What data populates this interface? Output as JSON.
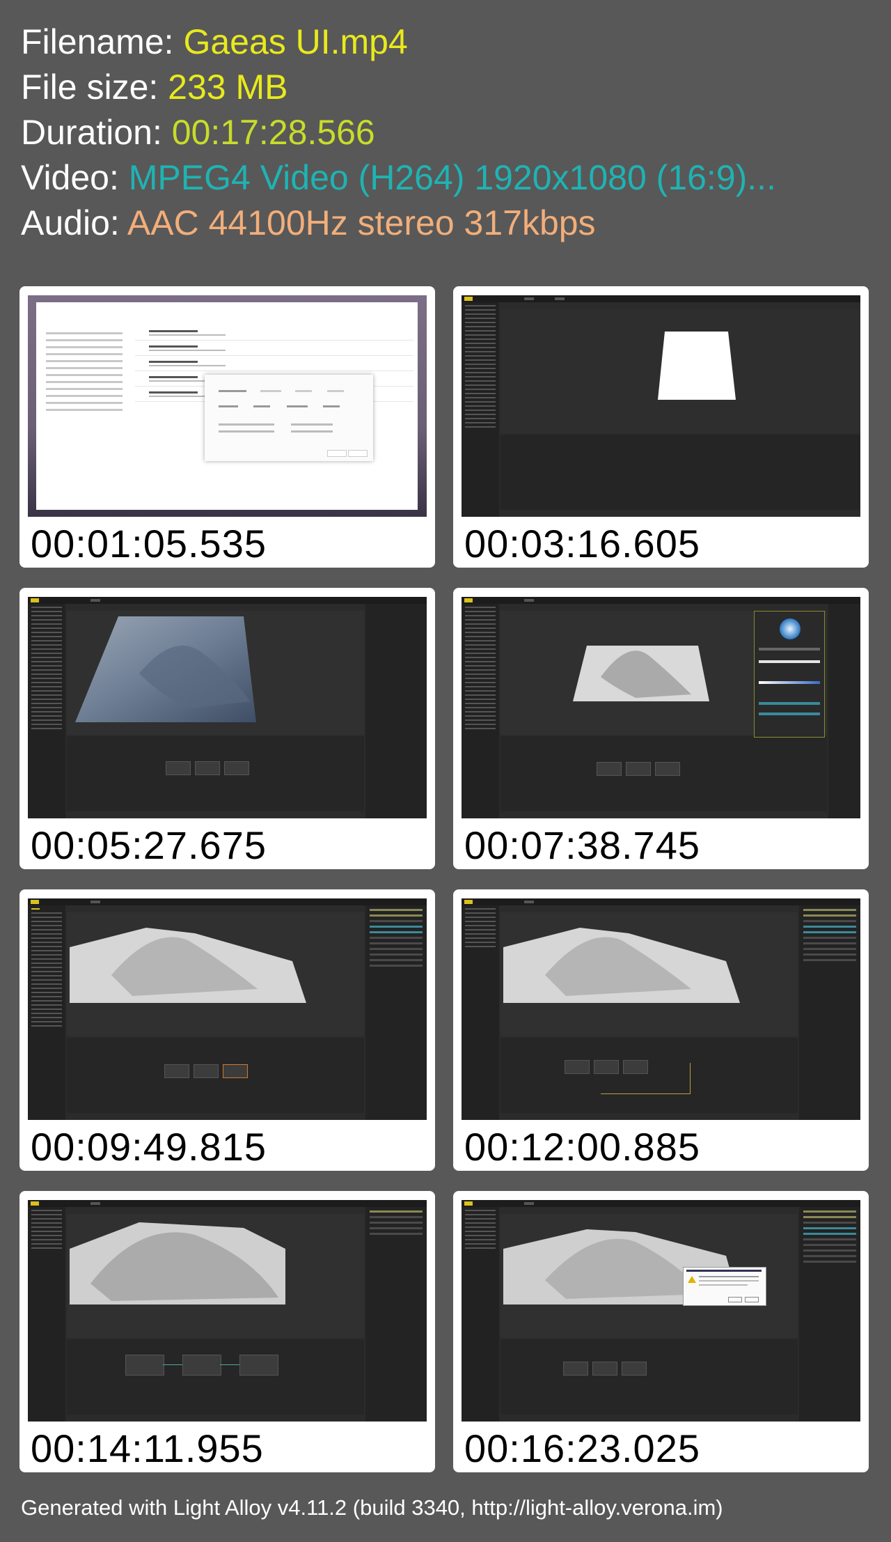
{
  "info": {
    "filename_label": "Filename:",
    "filename": "Gaeas UI.mp4",
    "filesize_label": "File size:",
    "filesize": "233 MB",
    "duration_label": "Duration:",
    "duration": "00:17:28.566",
    "video_label": "Video:",
    "video": "MPEG4 Video (H264) 1920x1080 (16:9)...",
    "audio_label": "Audio:",
    "audio": "AAC 44100Hz stereo 317kbps"
  },
  "colors": {
    "background": "#585858",
    "label": "#ffffff",
    "filename": "#e8ea1c",
    "filesize": "#e8ea1c",
    "duration": "#c8dc2a",
    "video": "#1fb3b3",
    "audio": "#f2ae7a"
  },
  "thumbnails": [
    {
      "timestamp": "00:01:05.535"
    },
    {
      "timestamp": "00:03:16.605"
    },
    {
      "timestamp": "00:05:27.675"
    },
    {
      "timestamp": "00:07:38.745"
    },
    {
      "timestamp": "00:09:49.815"
    },
    {
      "timestamp": "00:12:00.885"
    },
    {
      "timestamp": "00:14:11.955"
    },
    {
      "timestamp": "00:16:23.025"
    }
  ],
  "footer": "Generated with Light Alloy v4.11.2 (build 3340, http://light-alloy.verona.im)"
}
